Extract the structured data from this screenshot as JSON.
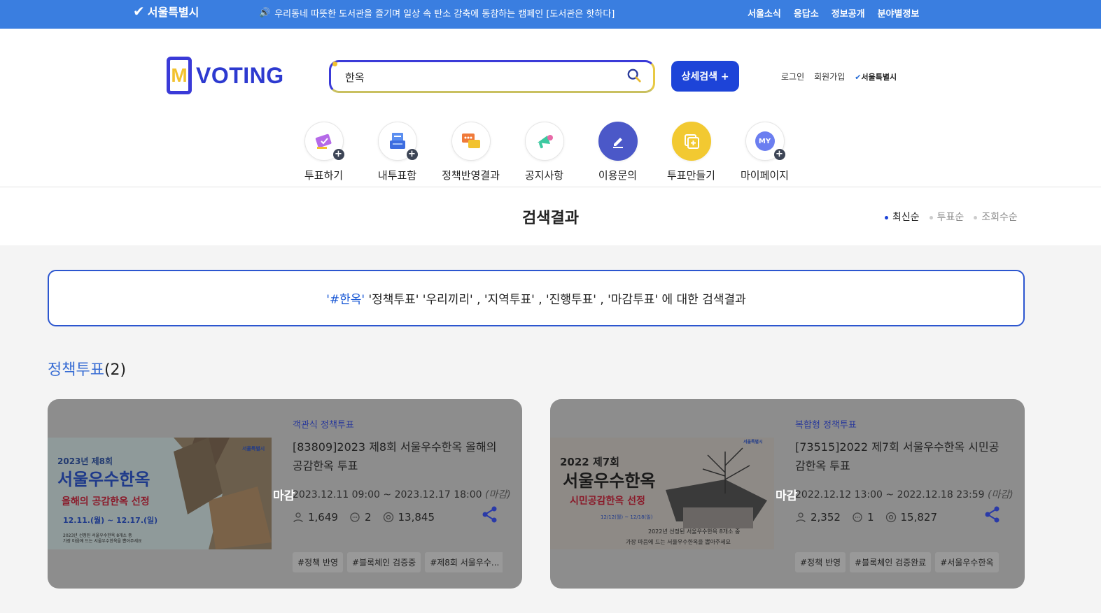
{
  "topbar": {
    "seoul_label": "서울특별시",
    "notice": "우리동네 따뜻한 도서관을 즐기며 일상 속 탄소 감축에 동참하는 캠페인 [도서관은 핫하다]",
    "nav": [
      "서울소식",
      "응답소",
      "정보공개",
      "분야별정보"
    ]
  },
  "header": {
    "logo_m": "M",
    "logo_text": "VOTING",
    "search_value": "한옥",
    "advanced_search": "상세검색 +",
    "login": "로그인",
    "signup": "회원가입",
    "seoul_small": "서울특별시",
    "quick_menu": [
      {
        "label": "투표하기",
        "icon": "vote-card-icon"
      },
      {
        "label": "내투표함",
        "icon": "ballot-box-icon"
      },
      {
        "label": "정책반영결과",
        "icon": "chat-bubbles-icon"
      },
      {
        "label": "공지사항",
        "icon": "megaphone-icon"
      },
      {
        "label": "이용문의",
        "icon": "pencil-icon"
      },
      {
        "label": "투표만들기",
        "icon": "add-document-icon"
      },
      {
        "label": "마이페이지",
        "icon": "my-icon",
        "icon_text": "MY"
      }
    ]
  },
  "results": {
    "title": "검색결과",
    "sort": [
      "최신순",
      "투표순",
      "조회수순"
    ],
    "sort_active": "최신순",
    "query_keyword": "'#한옥'",
    "query_rest": " '정책투표' '우리끼리' , '지역투표' , '진행투표' , '마감투표' 에 대한 검색결과"
  },
  "section": {
    "title": "정책투표",
    "count": "(2)"
  },
  "cards": [
    {
      "status": "마감",
      "category": "객관식 정책투표",
      "title": "[83809]2023 제8회 서울우수한옥 올해의 공감한옥 투표",
      "period": "2023.12.11 09:00 ~ 2023.12.17 18:00",
      "period_note": "(마감)",
      "participants": "1,649",
      "comments": "2",
      "views": "13,845",
      "tags": [
        "#정책 반영",
        "#블록체인 검증중",
        "#제8회 서울우수..."
      ],
      "thumb": {
        "year": "2023년 제8회",
        "main": "서울우수한옥",
        "sub": "올해의 공감한옥 선정",
        "dates": "12.11.(월) ~ 12.17.(일)",
        "desc1": "2023년 선정된 서울우수한옥 8개소 중",
        "desc2": "가장 마음에 드는 서울우수한옥을 뽑아주세요",
        "brand": "서울특별시"
      }
    },
    {
      "status": "마감",
      "category": "복합형 정책투표",
      "title": "[73515]2022 제7회 서울우수한옥 시민공감한옥 투표",
      "period": "2022.12.12 13:00 ~ 2022.12.18 23:59",
      "period_note": "(마감)",
      "participants": "2,352",
      "comments": "1",
      "views": "15,827",
      "tags": [
        "#정책 반영",
        "#블록체인 검증완료",
        "#서울우수한옥"
      ],
      "thumb": {
        "year": "2022 제7회",
        "main": "서울우수한옥",
        "sub": "시민공감한옥 선정",
        "dates": "12/12(월) ~ 12/18(일)",
        "desc1": "2022년 선정된 서울우수한옥 8개소 중",
        "desc2": "가장 마음에 드는 서울우수한옥을 뽑아주세요",
        "brand": "서울특별시"
      }
    }
  ],
  "colors": {
    "topbar": "#3a7ee0",
    "brand_blue": "#1d44d8",
    "brand_yellow": "#f2c22e",
    "card_overlay": "#8d8d8d"
  }
}
